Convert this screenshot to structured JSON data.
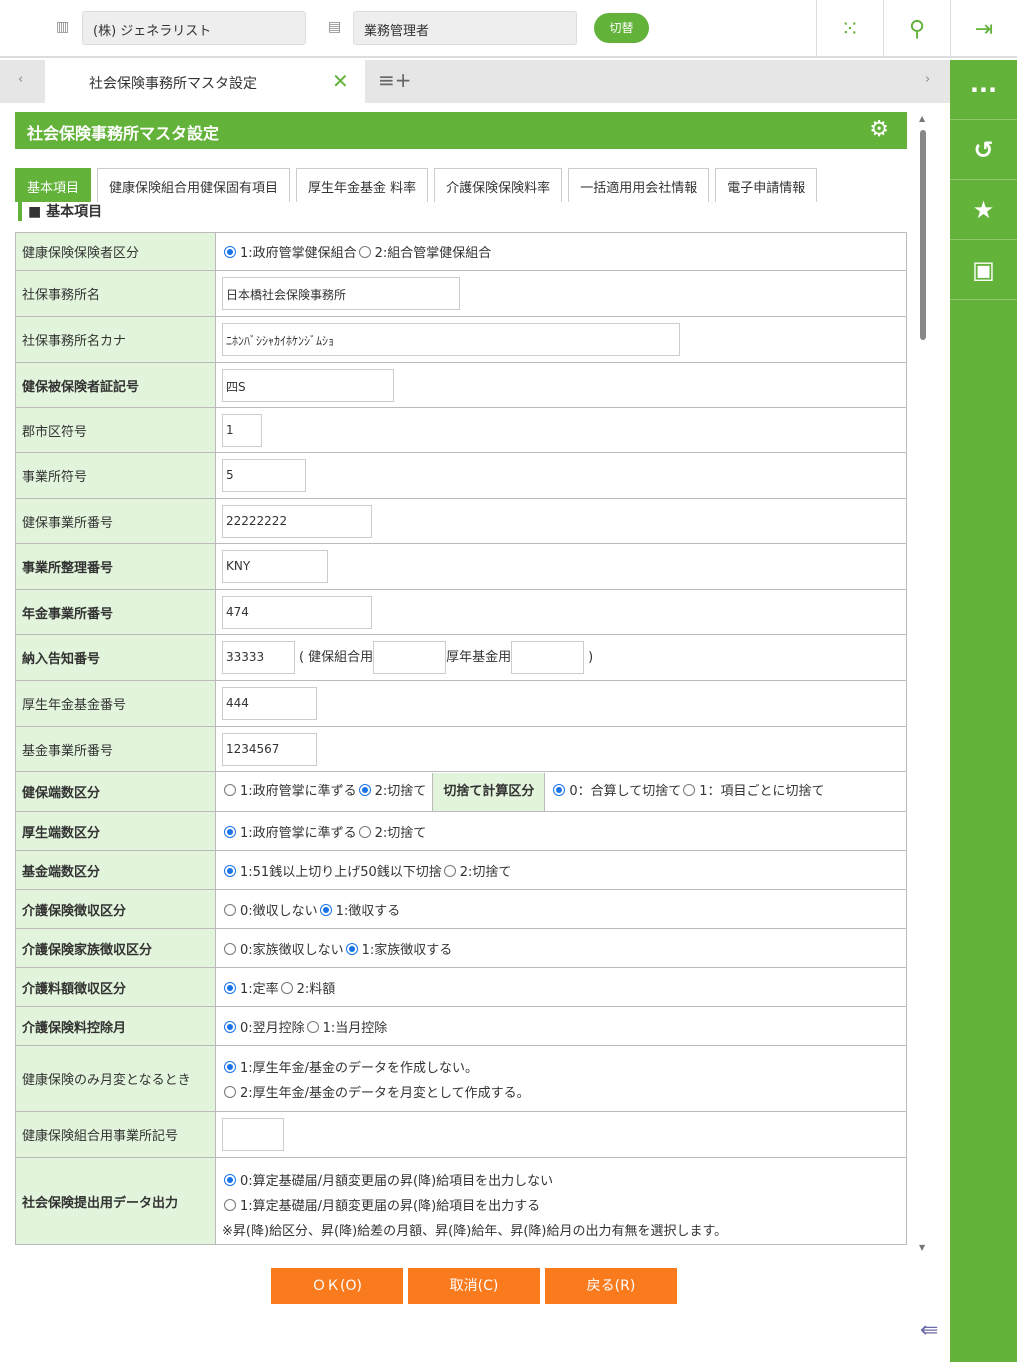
{
  "topbar": {
    "company": "(株) ジェネラリスト",
    "role": "業務管理者",
    "switch_label": "切替"
  },
  "tabbar": {
    "active_tab": "社会保険事務所マスタ設定"
  },
  "header": {
    "title": "社会保険事務所マスタ設定"
  },
  "tabs": [
    "基本項目",
    "健康保険組合用健保固有項目",
    "厚生年金基金 料率",
    "介護保険保険料率",
    "一括適用用会社情報",
    "電子申請情報"
  ],
  "section_title": "基本項目",
  "rows": [
    {
      "label": "健康保険保険者区分",
      "bold": false,
      "type": "radio",
      "options": [
        {
          "t": "1:政府管掌健保組合",
          "on": true
        },
        {
          "t": "2:組合管掌健保組合",
          "on": false
        }
      ]
    },
    {
      "label": "社保事務所名",
      "bold": false,
      "type": "input",
      "value": "日本橋社会保険事務所"
    },
    {
      "label": "社保事務所名カナ",
      "bold": false,
      "type": "input",
      "value": "ﾆﾎﾝﾊﾞｼｼｬｶｲﾎｹﾝｼﾞﾑｼｮ"
    },
    {
      "label": "健保被保険者証記号",
      "bold": true,
      "type": "input",
      "value": "四S"
    },
    {
      "label": "郡市区符号",
      "bold": false,
      "type": "input",
      "value": "1"
    },
    {
      "label": "事業所符号",
      "bold": false,
      "type": "input",
      "value": "5"
    },
    {
      "label": "健保事業所番号",
      "bold": false,
      "type": "input",
      "value": "22222222"
    },
    {
      "label": "事業所整理番号",
      "bold": true,
      "type": "input",
      "value": "KNY"
    },
    {
      "label": "年金事業所番号",
      "bold": true,
      "type": "input",
      "value": "474"
    },
    {
      "label": "納入告知番号",
      "bold": true,
      "type": "notice",
      "value": "33333",
      "open": "(",
      "kenpo_label": "健保組合用",
      "kenpo_value": "",
      "kikin_label": "厚年基金用",
      "kikin_value": "",
      "close": ")"
    },
    {
      "label": "厚生年金基金番号",
      "bold": false,
      "type": "input",
      "value": "444"
    },
    {
      "label": "基金事業所番号",
      "bold": false,
      "type": "input",
      "value": "1234567"
    },
    {
      "label": "健保端数区分",
      "bold": true,
      "type": "mixed",
      "options": [
        {
          "t": "1:政府管掌に準ずる",
          "on": false
        },
        {
          "t": "2:切捨て",
          "on": true
        }
      ],
      "sub_label": "切捨て計算区分",
      "sub_options": [
        {
          "t": "0：合算して切捨て",
          "on": true
        },
        {
          "t": "1：項目ごとに切捨て",
          "on": false
        }
      ]
    },
    {
      "label": "厚生端数区分",
      "bold": true,
      "type": "radio",
      "options": [
        {
          "t": "1:政府管掌に準ずる",
          "on": true
        },
        {
          "t": "2:切捨て",
          "on": false
        }
      ]
    },
    {
      "label": "基金端数区分",
      "bold": true,
      "type": "radio",
      "options": [
        {
          "t": "1:51銭以上切り上げ50銭以下切捨",
          "on": true
        },
        {
          "t": "2:切捨て",
          "on": false
        }
      ]
    },
    {
      "label": "介護保険徴収区分",
      "bold": true,
      "type": "radio",
      "options": [
        {
          "t": "0:徴収しない",
          "on": false
        },
        {
          "t": "1:徴収する",
          "on": true
        }
      ]
    },
    {
      "label": "介護保険家族徴収区分",
      "bold": true,
      "type": "radio",
      "options": [
        {
          "t": "0:家族徴収しない",
          "on": false
        },
        {
          "t": "1:家族徴収する",
          "on": true
        }
      ]
    },
    {
      "label": "介護料額徴収区分",
      "bold": true,
      "type": "radio",
      "options": [
        {
          "t": "1:定率",
          "on": true
        },
        {
          "t": "2:料額",
          "on": false
        }
      ]
    },
    {
      "label": "介護保険料控除月",
      "bold": true,
      "type": "radio",
      "options": [
        {
          "t": "0:翌月控除",
          "on": true
        },
        {
          "t": "1:当月控除",
          "on": false
        }
      ]
    },
    {
      "label": "健康保険のみ月変となるとき",
      "bold": false,
      "type": "radiov",
      "options": [
        {
          "t": "1:厚生年金/基金のデータを作成しない。",
          "on": true
        },
        {
          "t": "2:厚生年金/基金のデータを月変として作成する。",
          "on": false
        }
      ]
    },
    {
      "label": "健康保険組合用事業所記号",
      "bold": false,
      "type": "input",
      "value": ""
    },
    {
      "label": "社会保険提出用データ出力",
      "bold": true,
      "type": "radiov",
      "options": [
        {
          "t": "0:算定基礎届/月額変更届の昇(降)給項目を出力しない",
          "on": true
        },
        {
          "t": "1:算定基礎届/月額変更届の昇(降)給項目を出力する",
          "on": false
        }
      ],
      "note": "※昇(降)給区分、昇(降)給差の月額、昇(降)給年、昇(降)給月の出力有無を選択します。"
    }
  ],
  "buttons": {
    "ok": "ＯＫ(O)",
    "cancel": "取消(C)",
    "back": "戻る(R)"
  }
}
